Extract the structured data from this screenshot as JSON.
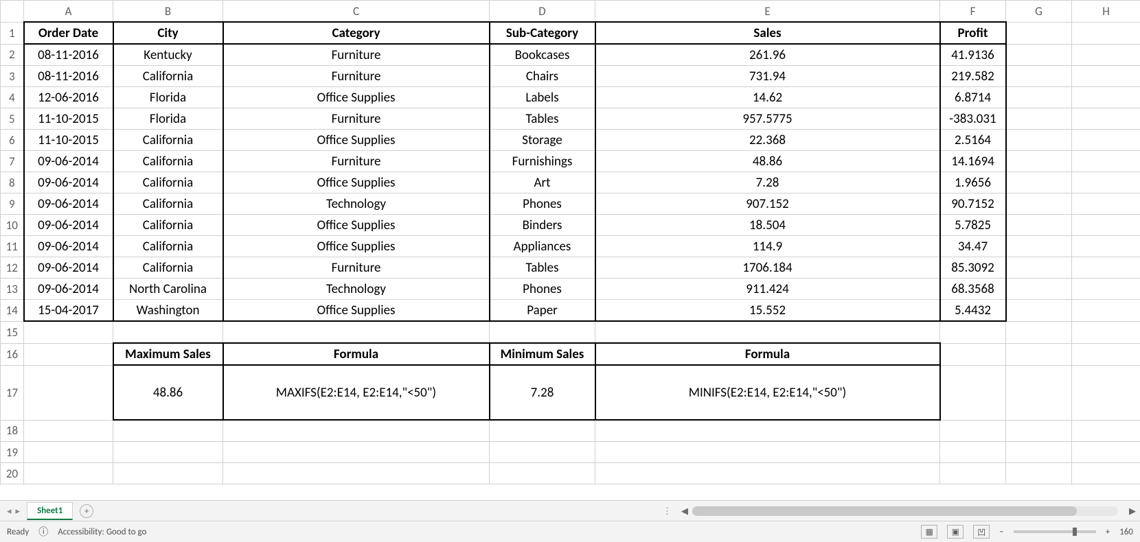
{
  "columns": [
    "A",
    "B",
    "C",
    "D",
    "E",
    "F",
    "G",
    "H"
  ],
  "headers": {
    "A": "Order Date",
    "B": "City",
    "C": "Category",
    "D": "Sub-Category",
    "E": "Sales",
    "F": "Profit"
  },
  "rows": [
    {
      "A": "08-11-2016",
      "B": "Kentucky",
      "C": "Furniture",
      "D": "Bookcases",
      "E": "261.96",
      "F": "41.9136"
    },
    {
      "A": "08-11-2016",
      "B": "California",
      "C": "Furniture",
      "D": "Chairs",
      "E": "731.94",
      "F": "219.582"
    },
    {
      "A": "12-06-2016",
      "B": "Florida",
      "C": "Office Supplies",
      "D": "Labels",
      "E": "14.62",
      "F": "6.8714"
    },
    {
      "A": "11-10-2015",
      "B": "Florida",
      "C": "Furniture",
      "D": "Tables",
      "E": "957.5775",
      "F": "-383.031"
    },
    {
      "A": "11-10-2015",
      "B": "California",
      "C": "Office Supplies",
      "D": "Storage",
      "E": "22.368",
      "F": "2.5164"
    },
    {
      "A": "09-06-2014",
      "B": "California",
      "C": "Furniture",
      "D": "Furnishings",
      "E": "48.86",
      "F": "14.1694"
    },
    {
      "A": "09-06-2014",
      "B": "California",
      "C": "Office Supplies",
      "D": "Art",
      "E": "7.28",
      "F": "1.9656"
    },
    {
      "A": "09-06-2014",
      "B": "California",
      "C": "Technology",
      "D": "Phones",
      "E": "907.152",
      "F": "90.7152"
    },
    {
      "A": "09-06-2014",
      "B": "California",
      "C": "Office Supplies",
      "D": "Binders",
      "E": "18.504",
      "F": "5.7825"
    },
    {
      "A": "09-06-2014",
      "B": "California",
      "C": "Office Supplies",
      "D": "Appliances",
      "E": "114.9",
      "F": "34.47"
    },
    {
      "A": "09-06-2014",
      "B": "California",
      "C": "Furniture",
      "D": "Tables",
      "E": "1706.184",
      "F": "85.3092"
    },
    {
      "A": "09-06-2014",
      "B": "North Carolina",
      "C": "Technology",
      "D": "Phones",
      "E": "911.424",
      "F": "68.3568"
    },
    {
      "A": "15-04-2017",
      "B": "Washington",
      "C": "Office Supplies",
      "D": "Paper",
      "E": "15.552",
      "F": "5.4432"
    }
  ],
  "summary": {
    "r16": {
      "B": "Maximum Sales",
      "C": "Formula",
      "D": "Minimum Sales",
      "E": "Formula"
    },
    "r17": {
      "B": "48.86",
      "C": "MAXIFS(E2:E14, E2:E14,\"<50\")",
      "D": "7.28",
      "E": "MINIFS(E2:E14, E2:E14,\"<50\")"
    }
  },
  "tabs": {
    "active": "Sheet1"
  },
  "status": {
    "ready": "Ready",
    "accessibility": "Accessibility: Good to go",
    "zoom": "160"
  },
  "nav": {
    "prev": "◂",
    "next": "▸",
    "plus": "+",
    "dots": "⋮",
    "left": "◀",
    "right": "▶",
    "minus": "−",
    "plus2": "+"
  },
  "icons": {
    "normal": "▦",
    "pagelayout": "▣",
    "pagebreak": "凹"
  }
}
